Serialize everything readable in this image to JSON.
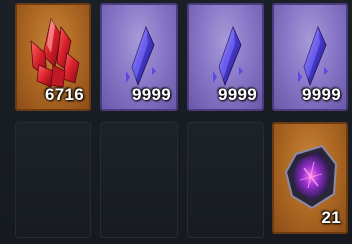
{
  "inventory": {
    "slots": [
      {
        "item": "red-crystal-cluster",
        "rarity": "orange",
        "count": "6716"
      },
      {
        "item": "purple-crystal-shard",
        "rarity": "purple",
        "count": "9999"
      },
      {
        "item": "purple-crystal-shard",
        "rarity": "purple",
        "count": "9999"
      },
      {
        "item": "purple-crystal-shard",
        "rarity": "purple",
        "count": "9999"
      },
      {
        "item": "empty",
        "rarity": "none",
        "count": ""
      },
      {
        "item": "empty",
        "rarity": "none",
        "count": ""
      },
      {
        "item": "empty",
        "rarity": "none",
        "count": ""
      },
      {
        "item": "violet-geode-stone",
        "rarity": "orange",
        "count": "21"
      }
    ]
  },
  "colors": {
    "orange_rarity": "#b06a24",
    "purple_rarity": "#8a79c8",
    "background": "#161a20"
  }
}
